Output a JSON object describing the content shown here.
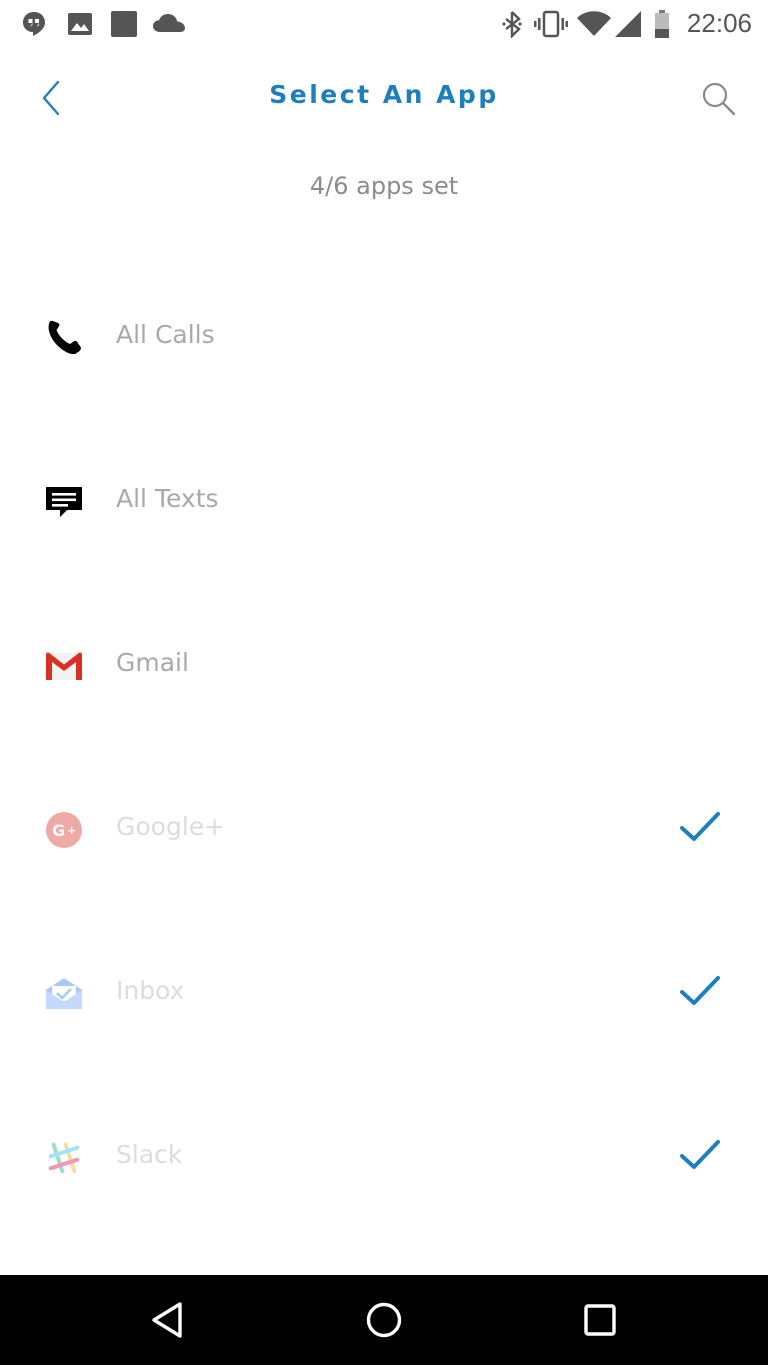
{
  "status_bar": {
    "time": "22:06",
    "left_icons": [
      "hangouts-icon",
      "image-icon",
      "square-app-icon",
      "cloud-icon"
    ],
    "right_icons": [
      "bluetooth-icon",
      "vibrate-icon",
      "wifi-icon",
      "cellular-signal-icon",
      "battery-icon"
    ]
  },
  "header": {
    "title": "Select An App",
    "back_icon": "chevron-left-icon",
    "search_icon": "search-icon"
  },
  "summary": {
    "apps_set": "4/6 apps set"
  },
  "apps": [
    {
      "label": "All Calls",
      "icon": "phone-icon",
      "selected": false
    },
    {
      "label": "All Texts",
      "icon": "message-icon",
      "selected": false
    },
    {
      "label": "Gmail",
      "icon": "gmail-icon",
      "selected": false
    },
    {
      "label": "Google+",
      "icon": "google-plus-icon",
      "selected": true
    },
    {
      "label": "Inbox",
      "icon": "inbox-icon",
      "selected": true
    },
    {
      "label": "Slack",
      "icon": "slack-icon",
      "selected": true
    }
  ],
  "colors": {
    "accent": "#1d7fbd",
    "label_text": "#a9a9a9",
    "label_text_selected": "#dcdcdc",
    "nav_bar": "#000000"
  },
  "nav_bar": {
    "icons": [
      "back-triangle-icon",
      "home-circle-icon",
      "recents-square-icon"
    ]
  }
}
